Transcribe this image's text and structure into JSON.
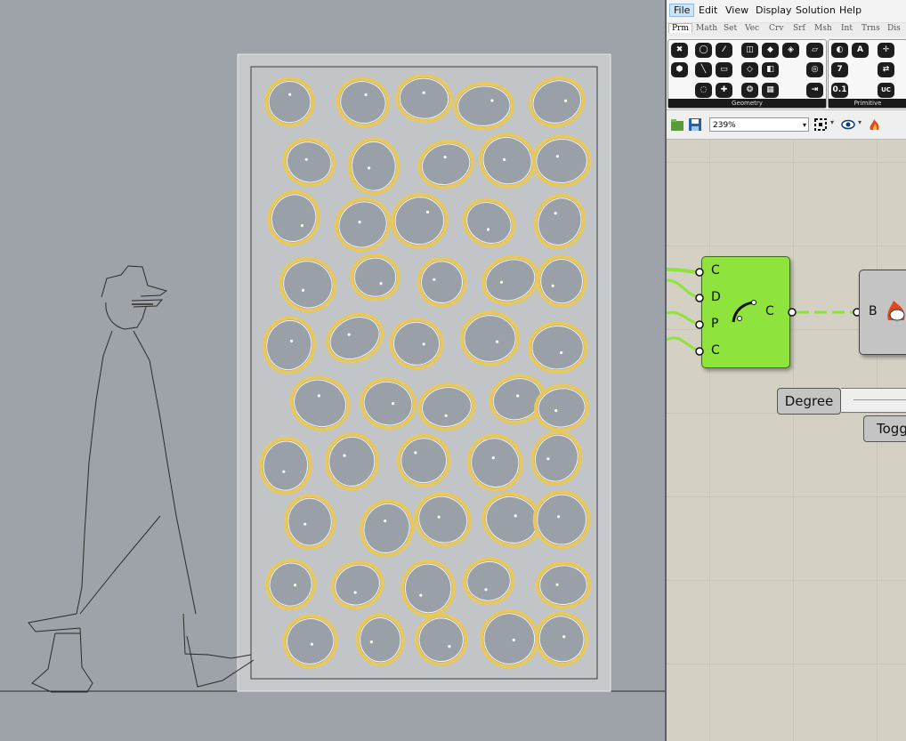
{
  "menu": {
    "file": "File",
    "edit": "Edit",
    "view": "View",
    "display": "Display",
    "solution": "Solution",
    "help": "Help"
  },
  "tabs": [
    "Prm",
    "Math",
    "Set",
    "Vec",
    "Crv",
    "Srf",
    "Msh",
    "Int",
    "Trns",
    "Dis"
  ],
  "ribbon": {
    "geometry_caption": "Geometry",
    "primitive_caption": "Primitive",
    "primitive_icons": {
      "number": "7",
      "decimal": "0.1",
      "letter": "A",
      "uc": "UC"
    }
  },
  "toolbar": {
    "zoom": "239%"
  },
  "canvas": {
    "component": {
      "inputs": [
        "C",
        "D",
        "P",
        "C"
      ],
      "output": "C"
    },
    "bake_node": {
      "input": "B"
    },
    "slider": {
      "label": "Degree"
    },
    "toggle": {
      "label": "Togg"
    }
  },
  "colors": {
    "viewport_bg": "#9ea3a9",
    "cell_stroke": "#e8c85a",
    "component_green": "#8ee33c",
    "canvas_bg": "#d4d1c4"
  }
}
